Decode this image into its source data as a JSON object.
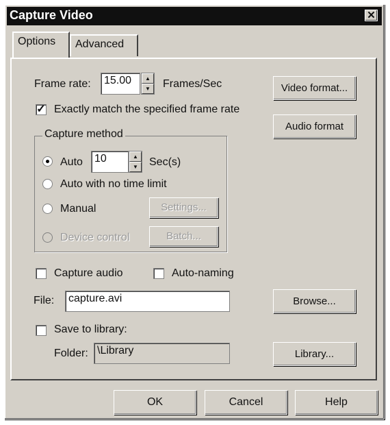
{
  "window": {
    "title": "Capture Video",
    "close_glyph": "✕"
  },
  "tabs": [
    {
      "label": "Options",
      "active": true
    },
    {
      "label": "Advanced",
      "active": false
    }
  ],
  "frame_rate": {
    "label": "Frame rate:",
    "value": "15.00",
    "unit": "Frames/Sec"
  },
  "exact_match": {
    "label": "Exactly match the specified frame rate",
    "checked": true
  },
  "capture_method": {
    "title": "Capture method",
    "auto": {
      "label": "Auto",
      "value": "10",
      "unit": "Sec(s)",
      "selected": true
    },
    "auto_no_limit": {
      "label": "Auto with no time limit"
    },
    "manual": {
      "label": "Manual",
      "settings_button": "Settings..."
    },
    "device_control": {
      "label": "Device control",
      "batch_button": "Batch..."
    }
  },
  "capture_audio": {
    "label": "Capture audio",
    "checked": false
  },
  "auto_naming": {
    "label": "Auto-naming",
    "checked": false
  },
  "file": {
    "label": "File:",
    "value": "capture.avi"
  },
  "save_to_library": {
    "label": "Save to library:",
    "checked": false
  },
  "folder": {
    "label": "Folder:",
    "value": "\\Library"
  },
  "side_buttons": {
    "video_format": "Video format...",
    "audio_format": "Audio format",
    "browse": "Browse...",
    "library": "Library..."
  },
  "footer": {
    "ok": "OK",
    "cancel": "Cancel",
    "help": "Help"
  },
  "icons": {
    "checkmark": "check-icon",
    "spin_up": "arrow-up-icon",
    "spin_down": "arrow-down-icon"
  },
  "colors": {
    "face": "#d4d0c8",
    "titlebar": "#101010",
    "field": "#ffffff"
  }
}
